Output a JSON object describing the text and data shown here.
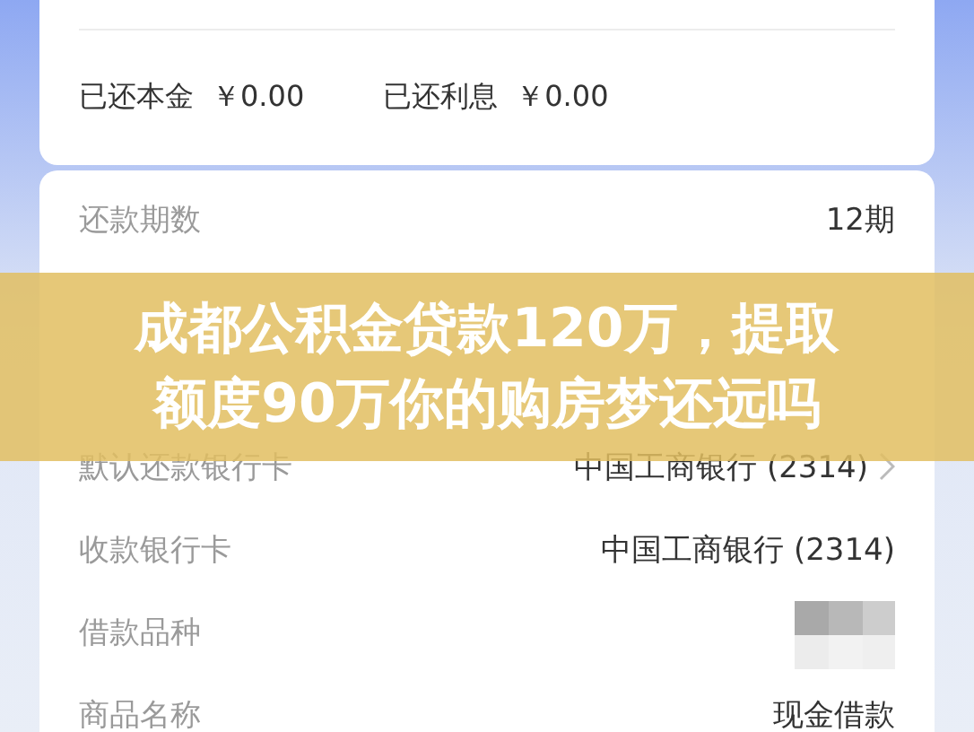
{
  "summary": [
    {
      "label": "已还本金",
      "amount": "￥0.00"
    },
    {
      "label": "已还利息",
      "amount": "￥0.00"
    }
  ],
  "details": [
    {
      "kind": "text",
      "label": "还款期数",
      "value": "12期",
      "chevron": false
    },
    {
      "kind": "covered"
    },
    {
      "kind": "covered"
    },
    {
      "kind": "text",
      "label": "默认还款银行卡",
      "value": "中国工商银行 (2314)",
      "chevron": true
    },
    {
      "kind": "text",
      "label": "收款银行卡",
      "value": "中国工商银行 (2314)",
      "chevron": false
    },
    {
      "kind": "masked",
      "label": "借款品种",
      "chevron": false
    },
    {
      "kind": "text",
      "label": "商品名称",
      "value": "现金借款",
      "chevron": false
    }
  ],
  "banner": {
    "title": "成都公积金贷款120万，提取额度90万你的购房梦还远吗"
  }
}
